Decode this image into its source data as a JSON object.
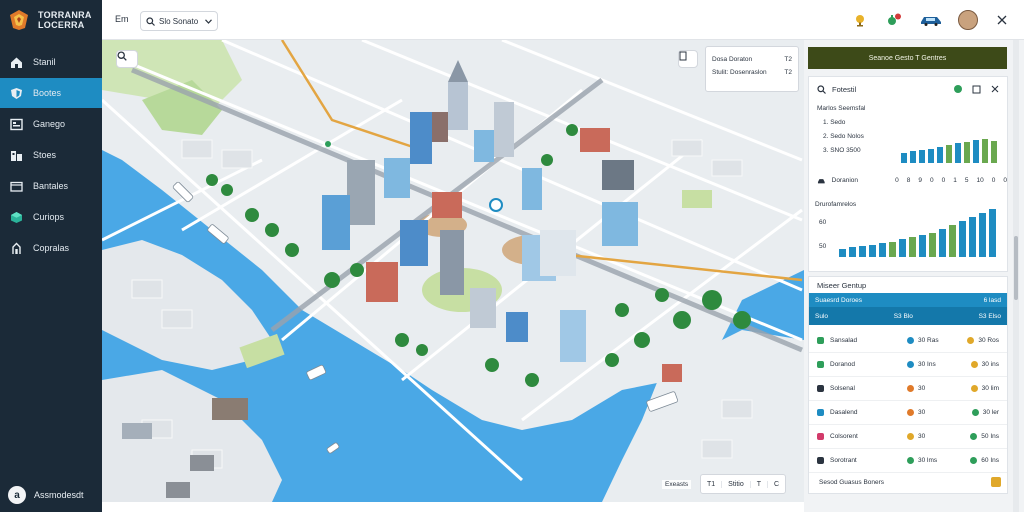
{
  "app": {
    "brand_name": "TORRANRA\nLOCERRA"
  },
  "sidebar": {
    "items": [
      {
        "label": "Stanil",
        "icon": "home-icon",
        "active": false
      },
      {
        "label": "Bootes",
        "icon": "shield-icon",
        "active": true
      },
      {
        "label": "Ganego",
        "icon": "dashboard-icon",
        "active": false
      },
      {
        "label": "Stoes",
        "icon": "building-icon",
        "active": false
      },
      {
        "label": "Bantales",
        "icon": "folder-icon",
        "active": false
      },
      {
        "label": "Curiops",
        "icon": "cube-icon",
        "active": false
      },
      {
        "label": "Copralas",
        "icon": "route-icon",
        "active": false
      }
    ],
    "footer": {
      "label": "Assmodesdt",
      "initial": "a"
    }
  },
  "topbar": {
    "label": "Em",
    "search_value": "Slo Sonato",
    "icons": [
      "trophy-icon",
      "notification-icon",
      "car-icon",
      "user-avatar",
      "close-icon"
    ]
  },
  "map": {
    "legend": {
      "row1_label": "Dosa Doraton",
      "row1_value": "T2",
      "row2_label": "Stulit: Dosenraslon",
      "row2_value": "T2"
    },
    "tools": [
      "T1",
      "Stitio",
      "T",
      "C"
    ],
    "scale_label": "Exeasts"
  },
  "panel": {
    "top_banner": "Seanoe Gesto T Gentres",
    "card1": {
      "title": "Fotestil",
      "line_title": "Marlos Seemsfal",
      "lines": [
        "1. Sedo",
        "2. Sedo Nolos",
        "3. SNO 3500"
      ],
      "chart1_label": "Doranion",
      "chart1_ticks": [
        "0",
        "8",
        "9",
        "0",
        "0",
        "1",
        "5",
        "10",
        "0",
        "0"
      ],
      "chart2_title": "Drurofamrelos",
      "chart2_ylabels": [
        "60",
        "50"
      ]
    },
    "card2": {
      "title": "Miseer Gentup",
      "header_row": {
        "c1": "Suaesrd Doroes",
        "c2": "",
        "c3": "6 lasd"
      },
      "highlight_row": {
        "c1": "Sulo",
        "c2": "S3 Blo",
        "c3": "S3 Elso"
      },
      "rows": [
        {
          "c1": "Sansalad",
          "c2": "30 Ras",
          "c3": "30 Ros",
          "color": "#2e9e5a",
          "c2color": "#1e8cc2",
          "c3color": "#e0a82a"
        },
        {
          "c1": "Doranod",
          "c2": "30 Ins",
          "c3": "30 ins",
          "color": "#2e9e5a",
          "c2color": "#1e8cc2",
          "c3color": "#e0a82a"
        },
        {
          "c1": "Solsenal",
          "c2": "30",
          "c3": "30 lim",
          "color": "#2b3440",
          "c2color": "#e07a2a",
          "c3color": "#e0a82a"
        },
        {
          "c1": "Dasalend",
          "c2": "30",
          "c3": "30 ler",
          "color": "#1e8cc2",
          "c2color": "#e07a2a",
          "c3color": "#2e9e5a"
        },
        {
          "c1": "Colsorent",
          "c2": "30",
          "c3": "50 Ins",
          "color": "#d23a6a",
          "c2color": "#e0a82a",
          "c3color": "#2e9e5a"
        },
        {
          "c1": "Sorotrant",
          "c2": "30 lms",
          "c3": "60 Ins",
          "color": "#2b3440",
          "c2color": "#2e9e5a",
          "c3color": "#2e9e5a"
        }
      ],
      "footer": "Sesod Guasus Boners"
    }
  },
  "colors": {
    "sidebar_bg": "#1b2a38",
    "accent": "#1e8cc2",
    "water": "#4aa8e6",
    "banner": "#3d4a18"
  }
}
